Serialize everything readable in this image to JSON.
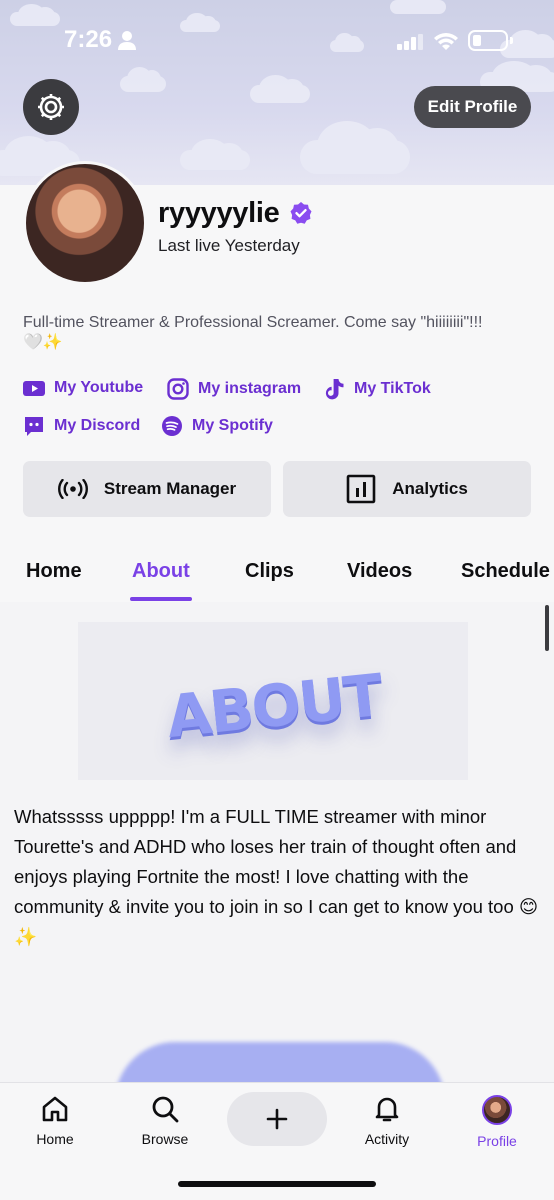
{
  "status_bar": {
    "time": "7:26"
  },
  "header": {
    "edit_profile_label": "Edit Profile"
  },
  "profile": {
    "username": "ryyyyylie",
    "last_live": "Last live Yesterday",
    "bio": "Full-time Streamer & Professional Screamer. Come say \"hiiiiiiii\"!!! 🤍✨"
  },
  "links": [
    {
      "label": "My Youtube",
      "icon": "youtube-icon"
    },
    {
      "label": "My instagram",
      "icon": "instagram-icon"
    },
    {
      "label": "My TikTok",
      "icon": "tiktok-icon"
    },
    {
      "label": "My Discord",
      "icon": "discord-icon"
    },
    {
      "label": "My Spotify",
      "icon": "spotify-icon"
    }
  ],
  "actions": {
    "stream_manager_label": "Stream Manager",
    "analytics_label": "Analytics"
  },
  "tabs": [
    "Home",
    "About",
    "Clips",
    "Videos",
    "Schedule"
  ],
  "active_tab": "About",
  "about": {
    "banner_word": "ABOUT",
    "text": "Whatsssss uppppp! I'm a FULL TIME streamer with minor Tourette's and ADHD who loses her train of thought often and enjoys playing Fortnite the most! I love chatting with the community & invite you to join in so I can get to know you too 😊✨"
  },
  "bottom_nav": [
    {
      "label": "Home",
      "icon": "home-icon"
    },
    {
      "label": "Browse",
      "icon": "search-icon"
    },
    {
      "label": "Activity",
      "icon": "bell-icon"
    },
    {
      "label": "Profile",
      "icon": "avatar"
    }
  ],
  "colors": {
    "accent": "#7a41e6",
    "link": "#6b2fd1"
  }
}
